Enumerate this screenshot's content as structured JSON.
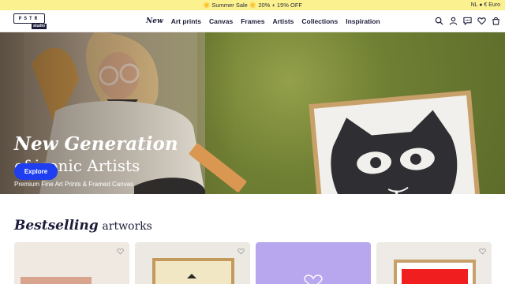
{
  "announcement": {
    "text": "☀️ Summer Sale ☀️ 20% + 15% OFF",
    "locale": "NL ● € Euro"
  },
  "logo": {
    "letters": "PSTR",
    "sub": "studio"
  },
  "nav": {
    "items": [
      {
        "label": "New"
      },
      {
        "label": "Art prints"
      },
      {
        "label": "Canvas"
      },
      {
        "label": "Frames"
      },
      {
        "label": "Artists"
      },
      {
        "label": "Collections"
      },
      {
        "label": "Inspiration"
      }
    ]
  },
  "header_icons": [
    "search-icon",
    "account-icon",
    "chat-icon",
    "wishlist-icon",
    "cart-icon"
  ],
  "hero": {
    "title_script": "New Generation",
    "title_line2": "of iconic Artists",
    "subtitle": "Premium Fine Art Prints & Framed Canvas",
    "cta_label": "Explore"
  },
  "bestselling": {
    "title_script": "Bestselling",
    "title_rest": "artworks",
    "cards": [
      {
        "icon": "heart-icon"
      },
      {
        "icon": "heart-icon"
      },
      {
        "icon": "heart-icon"
      },
      {
        "icon": "heart-icon"
      }
    ]
  },
  "colors": {
    "announcement_bg": "#fbf28f",
    "brand_dark": "#1c1c3a",
    "cta_blue": "#1e3ef0",
    "card_lilac": "#b8a7ee"
  }
}
